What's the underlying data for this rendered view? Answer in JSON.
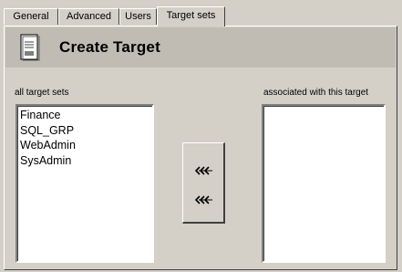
{
  "tabs": [
    {
      "label": "General",
      "active": false
    },
    {
      "label": "Advanced",
      "active": false
    },
    {
      "label": "Users",
      "active": false
    },
    {
      "label": "Target sets",
      "active": true
    }
  ],
  "header": {
    "title": "Create Target",
    "icon": "document-icon"
  },
  "left_list": {
    "label": "all target sets",
    "items": [
      "Finance",
      "SQL_GRP",
      "WebAdmin",
      "SysAdmin"
    ]
  },
  "right_list": {
    "label": "associated with this target",
    "items": []
  },
  "buttons": {
    "move_top_icon": "move-left-triple-chevron-icon",
    "move_bottom_icon": "move-left-triple-chevron-icon"
  }
}
